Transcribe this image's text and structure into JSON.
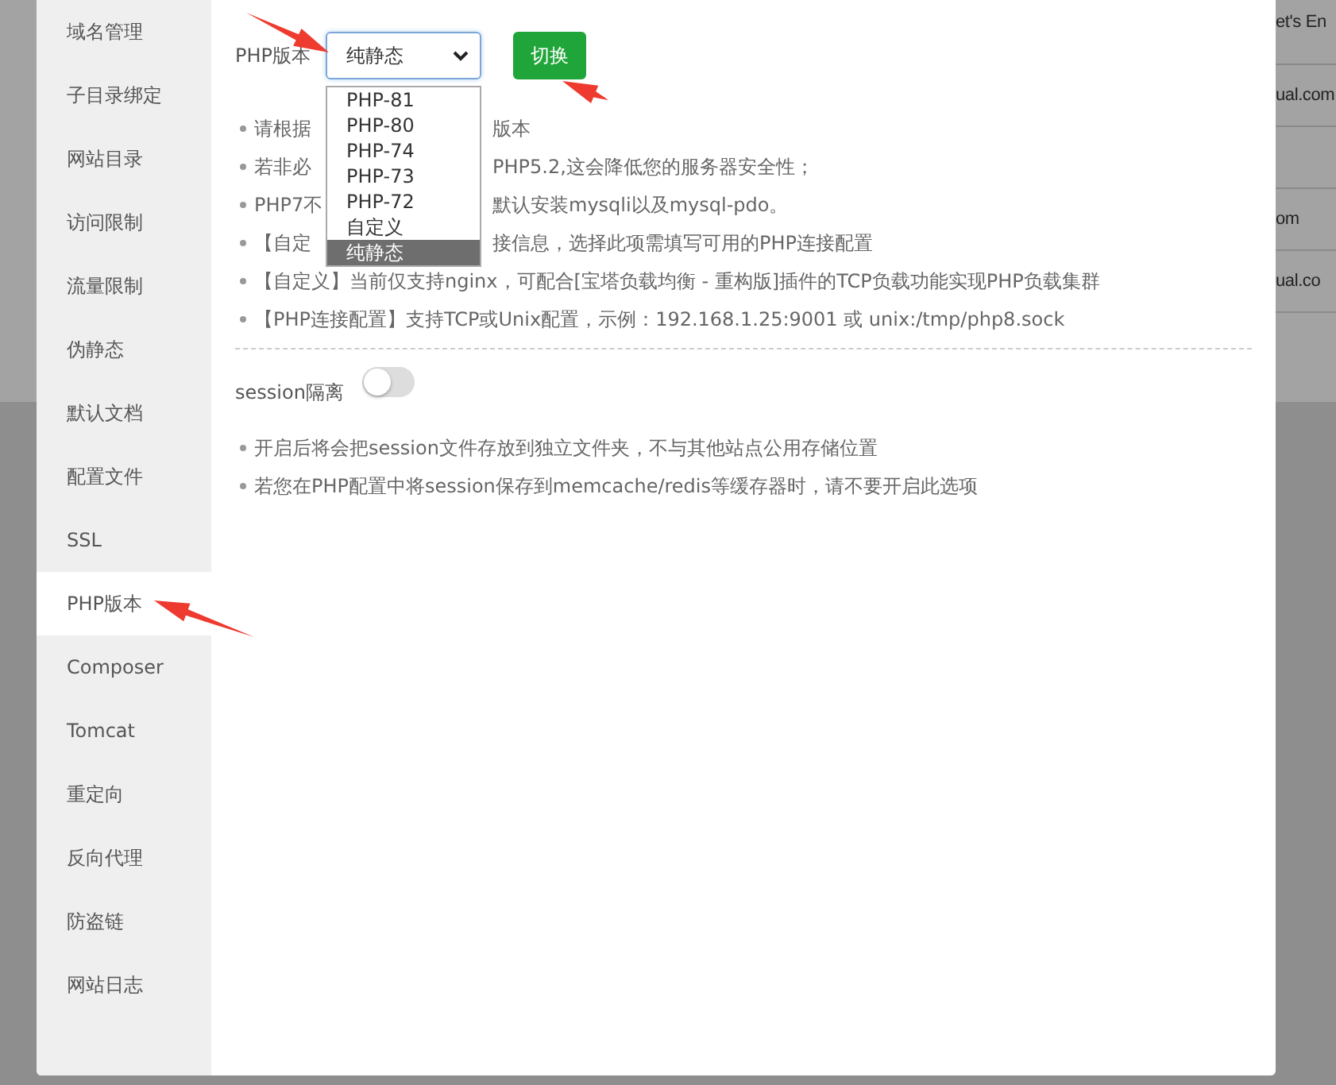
{
  "backdrop": {
    "cells": [
      "et's En",
      "ual.com",
      "",
      "om",
      "ual.co"
    ]
  },
  "sidebar": {
    "items": [
      {
        "label": "域名管理",
        "selected": false
      },
      {
        "label": "子目录绑定",
        "selected": false
      },
      {
        "label": "网站目录",
        "selected": false
      },
      {
        "label": "访问限制",
        "selected": false
      },
      {
        "label": "流量限制",
        "selected": false
      },
      {
        "label": "伪静态",
        "selected": false
      },
      {
        "label": "默认文档",
        "selected": false
      },
      {
        "label": "配置文件",
        "selected": false
      },
      {
        "label": "SSL",
        "selected": false
      },
      {
        "label": "PHP版本",
        "selected": true
      },
      {
        "label": "Composer",
        "selected": false
      },
      {
        "label": "Tomcat",
        "selected": false
      },
      {
        "label": "重定向",
        "selected": false
      },
      {
        "label": "反向代理",
        "selected": false
      },
      {
        "label": "防盗链",
        "selected": false
      },
      {
        "label": "网站日志",
        "selected": false
      }
    ]
  },
  "php_version": {
    "label": "PHP版本",
    "value": "纯静态",
    "expanded": true,
    "options": [
      {
        "label": "PHP-81",
        "selected": false
      },
      {
        "label": "PHP-80",
        "selected": false
      },
      {
        "label": "PHP-74",
        "selected": false
      },
      {
        "label": "PHP-73",
        "selected": false
      },
      {
        "label": "PHP-72",
        "selected": false
      },
      {
        "label": "自定义",
        "selected": false
      },
      {
        "label": "纯静态",
        "selected": true
      }
    ],
    "button": "切换"
  },
  "notes": [
    {
      "head": "请根据",
      "tail": "版本"
    },
    {
      "head": "若非必",
      "tail": "PHP5.2,这会降低您的服务器安全性；"
    },
    {
      "head": "PHP7不",
      "tail": "默认安装mysqli以及mysql-pdo。"
    },
    {
      "head": "【自定",
      "tail": "接信息，选择此项需填写可用的PHP连接配置"
    },
    {
      "text": "【自定义】当前仅支持nginx，可配合[宝塔负载均衡 - 重构版]插件的TCP负载功能实现PHP负载集群"
    },
    {
      "text": "【PHP连接配置】支持TCP或Unix配置，示例：192.168.1.25:9001 或 unix:/tmp/php8.sock"
    }
  ],
  "session": {
    "label": "session隔离",
    "on": false,
    "notes": [
      "开启后将会把session文件存放到独立文件夹，不与其他站点公用存储位置",
      "若您在PHP配置中将session保存到memcache/redis等缓存器时，请不要开启此选项"
    ]
  }
}
